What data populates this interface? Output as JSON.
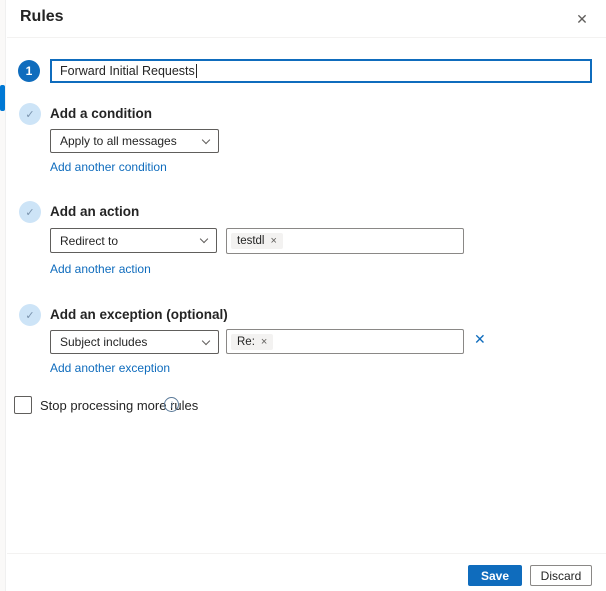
{
  "panel": {
    "title": "Rules"
  },
  "icons": {
    "close": "✕",
    "check": "✓",
    "chip_remove": "×",
    "remove_exception": "✕",
    "info": "i"
  },
  "rule": {
    "step_number": "1",
    "name_value": "Forward Initial Requests"
  },
  "sections": {
    "condition": {
      "heading": "Add a condition",
      "dropdown_value": "Apply to all messages",
      "link_label": "Add another condition"
    },
    "action": {
      "heading": "Add an action",
      "dropdown_value": "Redirect to",
      "chip": "testdl",
      "link_label": "Add another action"
    },
    "exception": {
      "heading": "Add an exception (optional)",
      "dropdown_value": "Subject includes",
      "chip": "Re:",
      "link_label": "Add another exception"
    }
  },
  "stop_processing": {
    "label": "Stop processing more rules"
  },
  "footer": {
    "save_label": "Save",
    "discard_label": "Discard"
  },
  "colors": {
    "primary": "#0F6CBD",
    "link": "#0F6CBD",
    "nav_pill": "#0078D4",
    "check_circle_bg": "#CDE4F7",
    "chip_bg": "#F3F2F1",
    "border_dark": "#605E5C",
    "border_light": "#8A8886"
  }
}
